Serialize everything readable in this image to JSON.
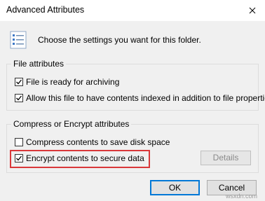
{
  "window": {
    "title": "Advanced Attributes"
  },
  "header": {
    "text": "Choose the settings you want for this folder."
  },
  "file_attributes": {
    "label": "File attributes",
    "options": [
      {
        "label": "File is ready for archiving",
        "checked": true
      },
      {
        "label": "Allow this file to have contents indexed in addition to file properties",
        "checked": true
      }
    ]
  },
  "compress_encrypt": {
    "label": "Compress or Encrypt attributes",
    "options": [
      {
        "label": "Compress contents to save disk space",
        "checked": false
      },
      {
        "label": "Encrypt contents to secure data",
        "checked": true
      }
    ],
    "details_label": "Details",
    "details_enabled": false
  },
  "buttons": {
    "ok_label": "OK",
    "cancel_label": "Cancel"
  },
  "highlight_color": "#d9383a",
  "watermark": "wsxdn.com"
}
